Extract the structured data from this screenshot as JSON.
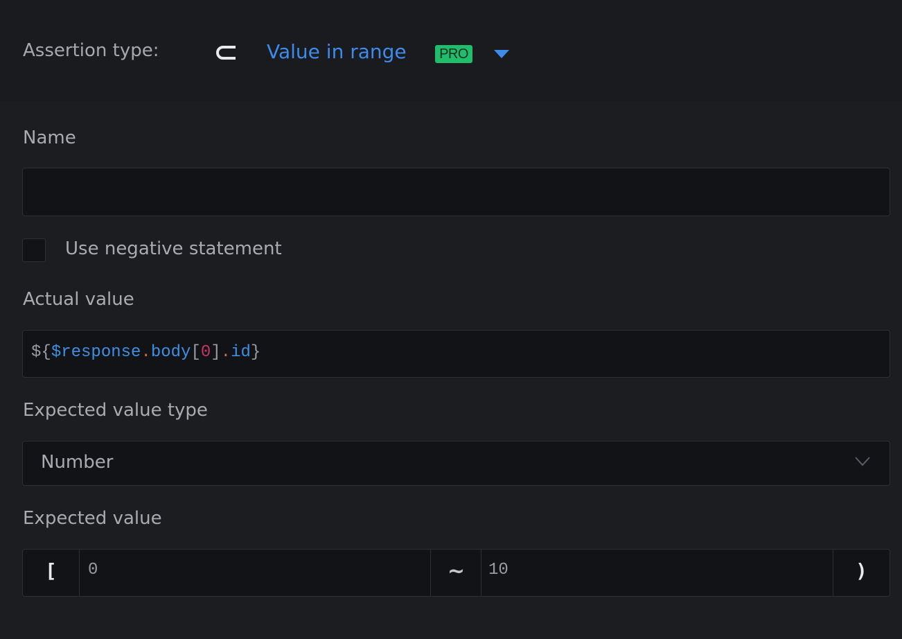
{
  "assertion": {
    "label": "Assertion type:",
    "icon": "subset-icon",
    "selected_type": "Value in range",
    "badge": "PRO",
    "caret_icon": "caret-down-icon"
  },
  "name_field": {
    "label": "Name",
    "value": ""
  },
  "negative_statement": {
    "label": "Use negative statement",
    "checked": false
  },
  "actual_value": {
    "label": "Actual value",
    "expression": {
      "open": "${",
      "variable": "$response",
      "dot1": ".",
      "property1": "body",
      "bracket_open": "[",
      "index": "0",
      "bracket_close": "]",
      "dot2": ".",
      "property2": "id",
      "close": "}"
    }
  },
  "expected_type": {
    "label": "Expected value type",
    "selected": "Number",
    "chevron_icon": "chevron-down-icon"
  },
  "expected_value": {
    "label": "Expected value",
    "lower_bracket": "[",
    "lower_value": "0",
    "separator": "~",
    "upper_value": "10",
    "upper_bracket": ")"
  },
  "colors": {
    "accent": "#3d8bea",
    "pro_badge": "#1fbd6c",
    "background": "#1a1b1f",
    "input_bg": "#121317"
  }
}
